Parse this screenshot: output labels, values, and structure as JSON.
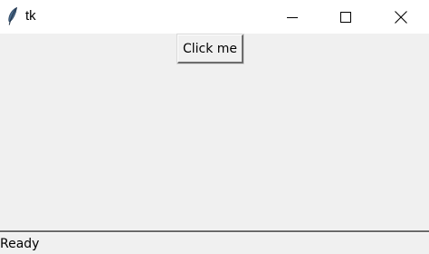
{
  "window": {
    "title": "tk",
    "icon": "feather-icon",
    "controls": {
      "minimize": "minimize-icon",
      "maximize": "maximize-icon",
      "close": "close-icon"
    }
  },
  "main": {
    "button_label": "Click me"
  },
  "status": {
    "text": "Ready"
  },
  "colors": {
    "window_bg": "#f0f0f0",
    "titlebar_bg": "#ffffff",
    "text": "#000000"
  }
}
